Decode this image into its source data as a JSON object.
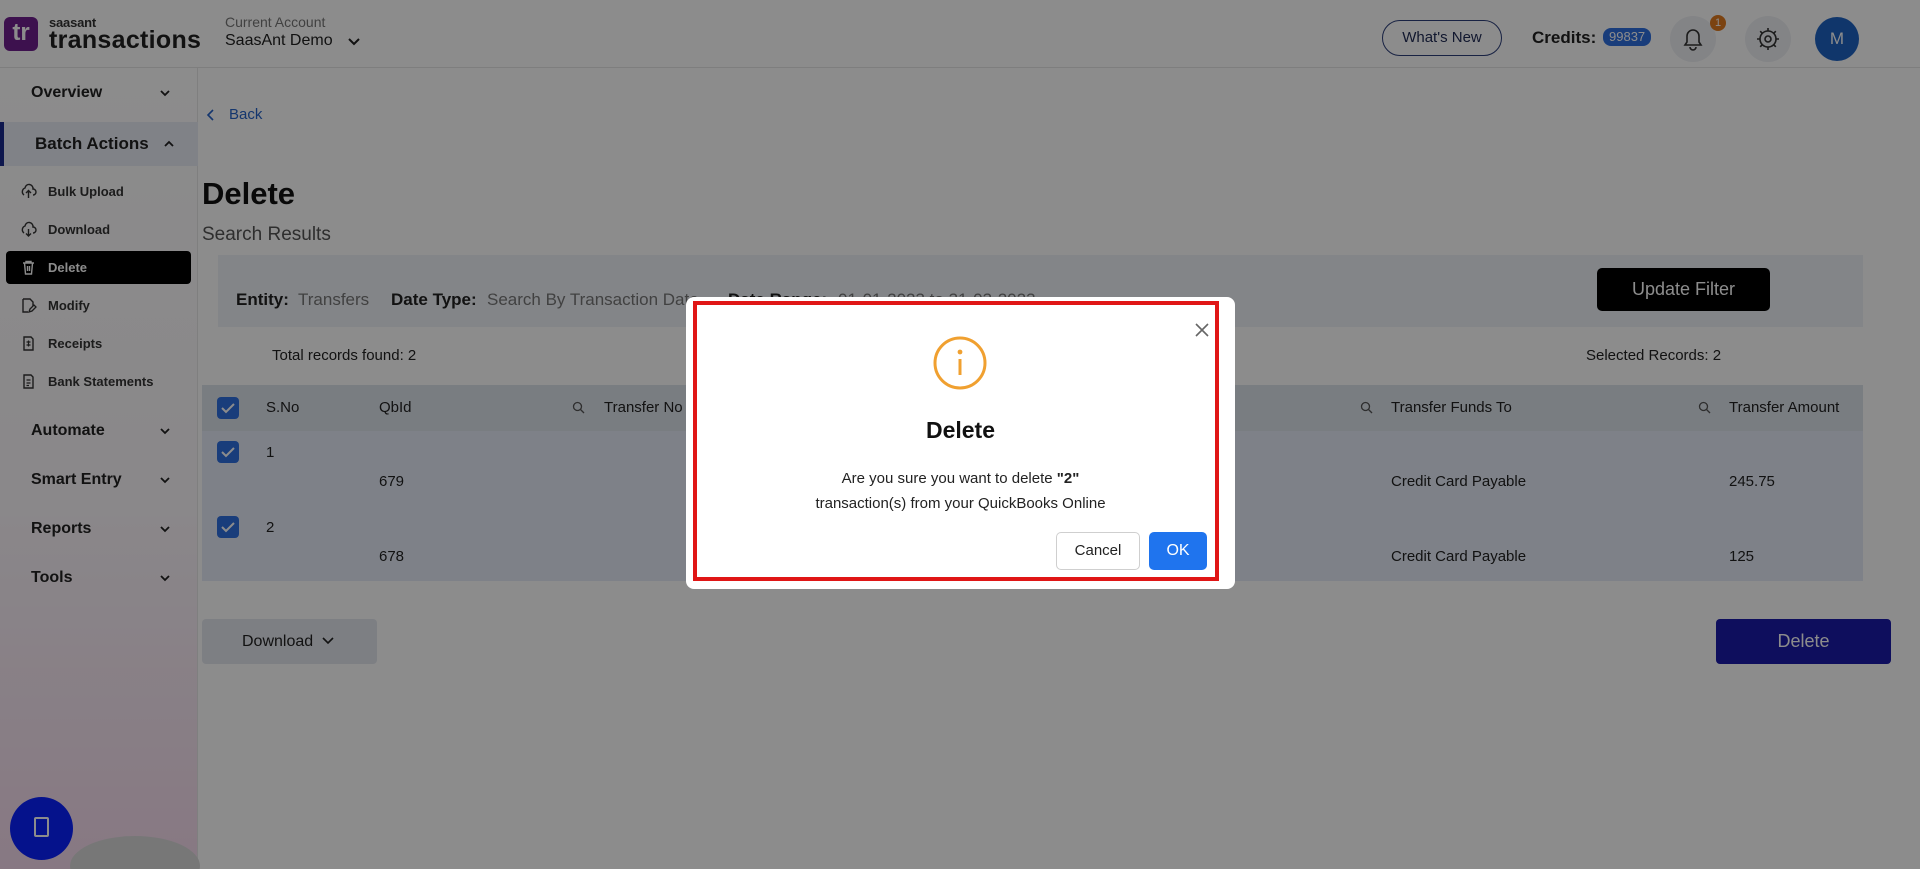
{
  "app": {
    "logo_mark": "tr",
    "logo_small": "saasant",
    "logo_big": "transactions"
  },
  "header": {
    "account_label": "Current Account",
    "account_name": "SaasAnt Demo",
    "whats_new": "What's New",
    "credits_label": "Credits:",
    "credits_value": "99837",
    "notification_count": "1",
    "avatar_initial": "M"
  },
  "sidebar": {
    "sections": [
      {
        "label": "Overview"
      },
      {
        "label": "Batch Actions"
      },
      {
        "label": "Automate"
      },
      {
        "label": "Smart Entry"
      },
      {
        "label": "Reports"
      },
      {
        "label": "Tools"
      }
    ],
    "items": [
      {
        "label": "Bulk Upload",
        "icon": "upload-cloud-icon"
      },
      {
        "label": "Download",
        "icon": "download-cloud-icon"
      },
      {
        "label": "Delete",
        "icon": "trash-icon"
      },
      {
        "label": "Modify",
        "icon": "edit-file-icon"
      },
      {
        "label": "Receipts",
        "icon": "receipt-icon"
      },
      {
        "label": "Bank Statements",
        "icon": "statement-icon"
      }
    ]
  },
  "main": {
    "back": "Back",
    "title": "Delete",
    "subtitle": "Search Results",
    "filters": {
      "entity_label": "Entity:",
      "entity_value": "Transfers",
      "date_type_label": "Date Type:",
      "date_type_value": "Search By Transaction Date",
      "date_range_label": "Date Range:",
      "date_range_value": "01-01-2023 to 31-03-2023"
    },
    "update_filter": "Update Filter",
    "total_records": "Total records found: 2",
    "selected_records": "Selected Records: 2",
    "columns": [
      "S.No",
      "QbId",
      "Transfer No",
      "Transfer Funds To",
      "Transfer Amount"
    ],
    "rows": [
      {
        "sno": "1",
        "qbid": "679",
        "funds_to": "Credit Card Payable",
        "amount": "245.75"
      },
      {
        "sno": "2",
        "qbid": "678",
        "funds_to": "Credit Card Payable",
        "amount": "125"
      }
    ],
    "download": "Download",
    "delete": "Delete"
  },
  "modal": {
    "title": "Delete",
    "line1_prefix": "Are you sure you want to delete ",
    "line1_count": "\"2\"",
    "line2": "transaction(s) from your QuickBooks Online",
    "cancel": "Cancel",
    "ok": "OK",
    "accent_color": "#f0a030",
    "highlight_color": "#e01616"
  }
}
